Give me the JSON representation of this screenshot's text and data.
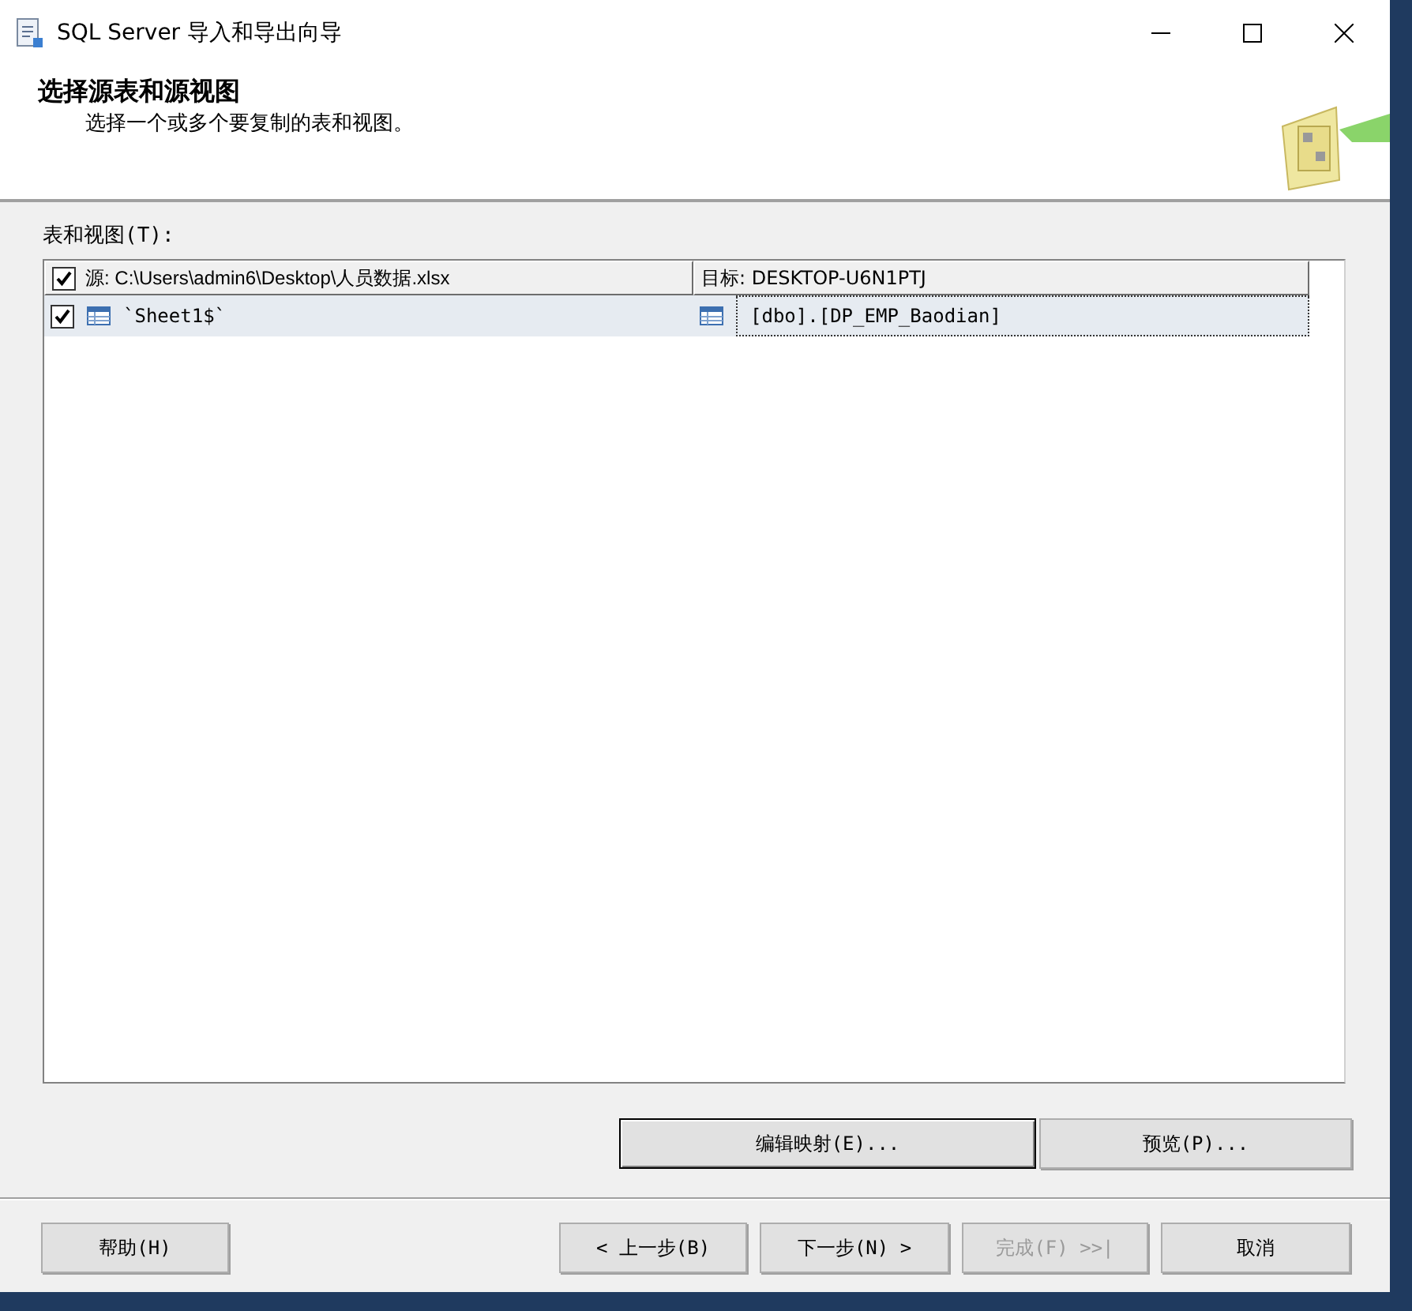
{
  "window": {
    "title": "SQL Server 导入和导出向导"
  },
  "header": {
    "title": "选择源表和源视图",
    "subtitle": "选择一个或多个要复制的表和视图。"
  },
  "table_label": "表和视图(T):",
  "table": {
    "all_checked": true,
    "columns": [
      "源: C:\\Users\\admin6\\Desktop\\人员数据.xlsx",
      "目标: DESKTOP-U6N1PTJ"
    ],
    "rows": [
      {
        "checked": true,
        "source": "`Sheet1$`",
        "target": "[dbo].[DP_EMP_Baodian]",
        "focused": true
      }
    ]
  },
  "actions": [
    {
      "label": "编辑映射(E)...",
      "default": true
    },
    {
      "label": "预览(P)...",
      "default": false
    }
  ],
  "footer_buttons": [
    {
      "label": "帮助(H)",
      "disabled": false
    },
    {
      "label": "< 上一步(B)",
      "disabled": false
    },
    {
      "label": "下一步(N) >",
      "disabled": false
    },
    {
      "label": "完成(F) >>|",
      "disabled": true
    },
    {
      "label": "取消",
      "disabled": false
    }
  ]
}
